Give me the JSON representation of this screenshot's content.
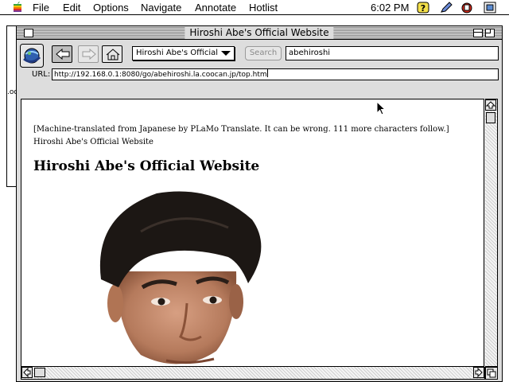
{
  "menubar": {
    "apple_icon": "apple-logo-icon",
    "items": [
      "File",
      "Edit",
      "Options",
      "Navigate",
      "Annotate",
      "Hotlist"
    ],
    "clock": "6:02 PM",
    "status_icons": [
      "help-icon",
      "pencil-icon",
      "app-menu-icon",
      "application-switcher-icon"
    ]
  },
  "background_window": {
    "partial_text": "...",
    "partial_label": ".oo"
  },
  "window": {
    "title": "Hiroshi Abe's Official Website"
  },
  "toolbar": {
    "logo_icon": "browser-logo-icon",
    "back_icon": "arrow-left-icon",
    "forward_icon": "arrow-right-icon",
    "home_icon": "home-icon",
    "title_select": "Hiroshi Abe's Official",
    "search_button": "Search",
    "search_value": "abehiroshi",
    "url_label": "URL:",
    "url_value": "http://192.168.0.1:8080/go/abehiroshi.la.coocan.jp/top.htm"
  },
  "page": {
    "note": "[Machine-translated from Japanese by PLaMo Translate. It can be wrong. 111 more characters follow.] Hiroshi Abe's Official Website",
    "heading": "Hiroshi Abe's Official Website"
  },
  "colors": {
    "window_chrome": "#dddddd",
    "title_stripes": "#8a8a8a",
    "content_bg": "#ffffff",
    "disabled_text": "#8a8a8a"
  }
}
